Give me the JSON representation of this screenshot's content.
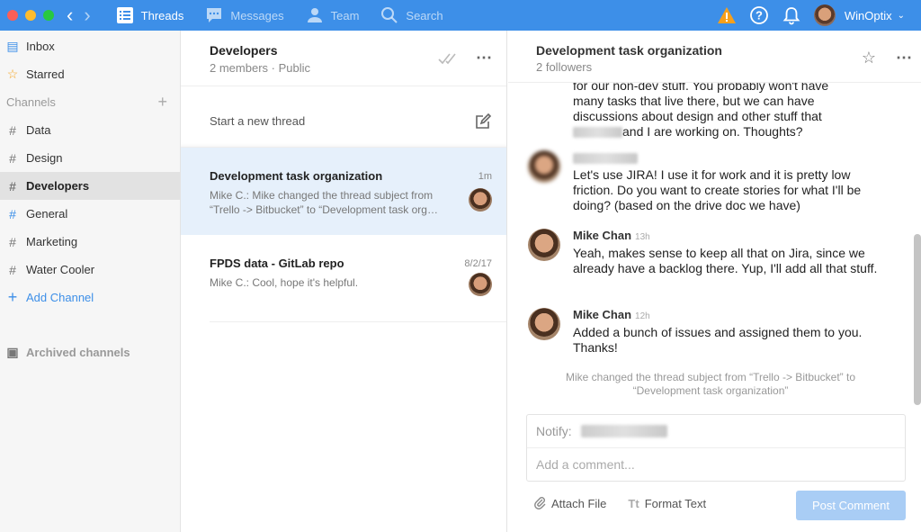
{
  "topbar": {
    "nav": [
      {
        "label": "Threads",
        "icon": "threads-icon",
        "active": true
      },
      {
        "label": "Messages",
        "icon": "messages-icon",
        "active": false
      },
      {
        "label": "Team",
        "icon": "team-icon",
        "active": false
      },
      {
        "label": "Search",
        "icon": "search-icon",
        "active": false
      }
    ],
    "user_name": "WinOptix",
    "accent_color": "#3d8fe8"
  },
  "sidebar": {
    "top_items": [
      {
        "label": "Inbox",
        "icon": "inbox-icon"
      },
      {
        "label": "Starred",
        "icon": "star-icon"
      }
    ],
    "channels_heading": "Channels",
    "channels": [
      {
        "label": "Data",
        "active": false
      },
      {
        "label": "Design",
        "active": false
      },
      {
        "label": "Developers",
        "active": true
      },
      {
        "label": "General",
        "active": false
      },
      {
        "label": "Marketing",
        "active": false
      },
      {
        "label": "Water Cooler",
        "active": false
      }
    ],
    "add_channel": "Add Channel",
    "archived": "Archived channels"
  },
  "thread_list": {
    "title": "Developers",
    "subtitle": "2 members · Public",
    "new_thread": "Start a new thread",
    "threads": [
      {
        "title": "Development task organization",
        "time": "1m",
        "snippet": "Mike C.: Mike changed the thread subject from “Trello -> Bitbucket” to “Development task org…"
      },
      {
        "title": "FPDS data - GitLab repo",
        "time": "8/2/17",
        "snippet": "Mike C.: Cool, hope it's helpful."
      }
    ]
  },
  "detail": {
    "title": "Development task organization",
    "subtitle": "2 followers",
    "messages": [
      {
        "lines": [
          "for our non-dev stuff. You probably won't have",
          "many tasks that live there, but we can have",
          "discussions about design and other stuff that",
          "and I are working on. Thoughts?"
        ]
      },
      {
        "author": "",
        "time": "",
        "text": "Let's use JIRA! I use it for work and it is pretty low friction. Do you want to create stories for what I'll be doing? (based on the drive doc we have)"
      },
      {
        "author": "Mike Chan",
        "time": "13h",
        "text": "Yeah, makes sense to keep all that on Jira, since we already have a backlog there. Yup, I'll add all that stuff."
      },
      {
        "author": "Mike Chan",
        "time": "12h",
        "text": "Added a bunch of issues and assigned them to you. Thanks!"
      }
    ],
    "system_message": "Mike changed the thread subject from “Trello -> Bitbucket” to “Development task organization”",
    "notify_label": "Notify:",
    "comment_placeholder": "Add a comment...",
    "attach_file": "Attach File",
    "format_text": "Format Text",
    "format_glyph": "Tt",
    "post_comment": "Post Comment"
  }
}
